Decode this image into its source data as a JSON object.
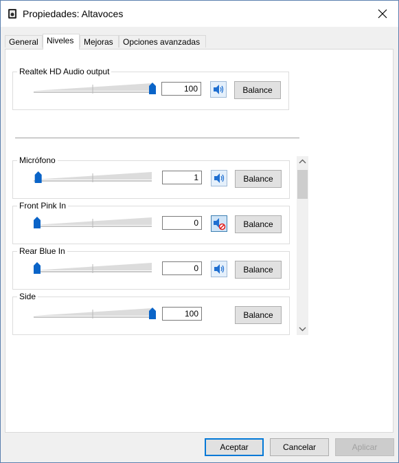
{
  "window": {
    "title": "Propiedades: Altavoces"
  },
  "tabs": [
    {
      "label": "General"
    },
    {
      "label": "Niveles"
    },
    {
      "label": "Mejoras"
    },
    {
      "label": "Opciones avanzadas"
    }
  ],
  "output": {
    "label": "Realtek HD Audio output",
    "value": "100",
    "level": 1.0,
    "balance_label": "Balance"
  },
  "inputs": [
    {
      "label": "Micrófono",
      "value": "1",
      "level": 0.01,
      "muted": false,
      "balance_label": "Balance"
    },
    {
      "label": "Front Pink In",
      "value": "0",
      "level": 0.0,
      "muted": true,
      "balance_label": "Balance"
    },
    {
      "label": "Rear Blue In",
      "value": "0",
      "level": 0.0,
      "muted": false,
      "balance_label": "Balance"
    },
    {
      "label": "Side",
      "value": "100",
      "level": 1.0,
      "balance_label": "Balance"
    }
  ],
  "footer": {
    "ok_label": "Aceptar",
    "cancel_label": "Cancelar",
    "apply_label": "Aplicar"
  },
  "colors": {
    "accent": "#0078d7",
    "slider_thumb": "#0a64c8"
  }
}
